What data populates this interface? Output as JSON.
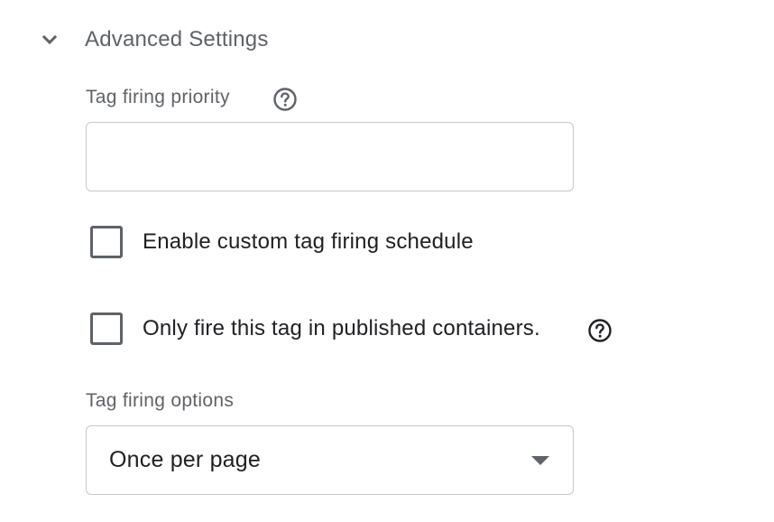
{
  "section": {
    "title": "Advanced Settings",
    "expanded_icon": "chevron-down-icon"
  },
  "priority": {
    "label": "Tag firing priority",
    "value": "",
    "help_icon": "help-icon"
  },
  "custom_schedule": {
    "label": "Enable custom tag firing schedule",
    "checked": false
  },
  "published_only": {
    "label": "Only fire this tag in published containers.",
    "checked": false,
    "help_icon": "help-icon"
  },
  "firing_options": {
    "label": "Tag firing options",
    "selected": "Once per page"
  },
  "colors": {
    "label_gray": "#5f6368",
    "text_dark": "#202124",
    "border": "#c7c9cc"
  }
}
